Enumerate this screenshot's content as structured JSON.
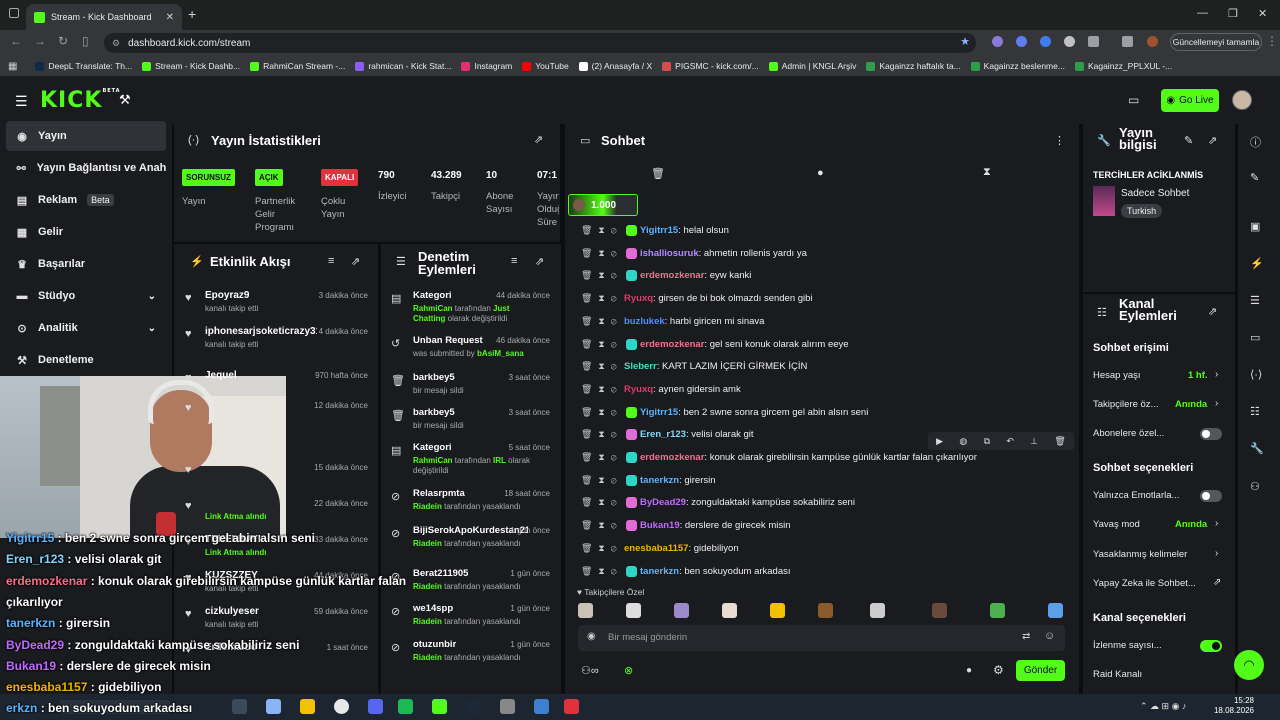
{
  "browser": {
    "tab_title": "Stream - Kick Dashboard",
    "url": "dashboard.kick.com/stream",
    "update_label": "Güncellemeyi tamamla",
    "bookmarks": [
      "DeepL Translate: Th...",
      "Stream - Kick Dashb...",
      "RahmiCan Stream -...",
      "rahmican - Kick Stat...",
      "Instagram",
      "YouTube",
      "(2) Anasayfa / X",
      "PIGSMC - kick.com/...",
      "Admin | KNGL Arşiv",
      "Kagainzz haftalık ta...",
      "Kagainzz beslenme...",
      "Kagainzz_PPLXUL -..."
    ],
    "bookmark_colors": [
      "#0f2b46",
      "#53fc18",
      "#53fc18",
      "#8b5cf6",
      "#e1306c",
      "#ff0000",
      "#ffffff",
      "#d94c4c",
      "#53fc18",
      "#2e9e4a",
      "#2e9e4a",
      "#2e9e4a"
    ]
  },
  "app": {
    "logo": "KICK",
    "logo_sup": "BETA",
    "go_live": "Go Live",
    "accent": "#53fc18"
  },
  "nav": [
    {
      "label": "Yayın",
      "icon": "broadcast-icon",
      "active": true
    },
    {
      "label": "Yayın Bağlantısı ve Anahtarı",
      "icon": "link-icon"
    },
    {
      "label": "Reklam",
      "icon": "ad-icon",
      "badge": "Beta"
    },
    {
      "label": "Gelir",
      "icon": "money-icon"
    },
    {
      "label": "Başarılar",
      "icon": "trophy-icon"
    },
    {
      "label": "Stüdyo",
      "icon": "studio-icon",
      "chevron": true
    },
    {
      "label": "Analitik",
      "icon": "chart-icon",
      "chevron": true
    },
    {
      "label": "Denetleme",
      "icon": "hammer-icon"
    }
  ],
  "stats": {
    "title": "Yayın İstatistikleri",
    "items": [
      {
        "badge": "SORUNSUZ",
        "label": "Yayın"
      },
      {
        "badge": "AÇIK",
        "label": "Partnerlik Gelir Programı"
      },
      {
        "badge": "KAPALI",
        "label": "Çoklu Yayın"
      },
      {
        "value": "790",
        "label": "İzleyici"
      },
      {
        "value": "43.289",
        "label": "Takipçi"
      },
      {
        "value": "10",
        "label": "Abone Sayısı"
      },
      {
        "value": "07:1",
        "label": "Yayın Olduğu Süre"
      }
    ]
  },
  "activity": {
    "title": "Etkinlik Akışı",
    "items": [
      {
        "name": "Epoyraz9",
        "sub": "kanalı takip etti",
        "time": "3 dakika önce"
      },
      {
        "name": "iphonesarjsoketicrazy31",
        "sub": "kanalı takip etti",
        "time": "4 dakika önce"
      },
      {
        "name": "Jequel",
        "sub": "",
        "time": "970 hafta önce"
      },
      {
        "name": "",
        "sub": "",
        "time": "12 dakika önce"
      },
      {
        "name": "",
        "sub": "",
        "time": "15 dakika önce"
      },
      {
        "name": "",
        "sub": "Link Atma alındı",
        "time": "22 dakika önce"
      },
      {
        "name": "TEKELBAYI",
        "sub": "Link Atma alındı",
        "time": "33 dakika önce"
      },
      {
        "name": "KUZSZZEY",
        "sub": "kanalı takip etti",
        "time": "44 dakika önce"
      },
      {
        "name": "cizkulyeser",
        "sub": "kanalı takip etti",
        "time": "59 dakika önce"
      },
      {
        "name": "Erdemaldo",
        "sub": "",
        "time": "1 saat önce"
      }
    ]
  },
  "moderation": {
    "title": "Denetim Eylemleri",
    "items": [
      {
        "name": "Kategori",
        "time": "44 dakika önce",
        "actor": "RahmiCan",
        "mid": " tarafından ",
        "target": "Just Chatting",
        "rest": " olarak değiştirildi",
        "icon": "category-icon"
      },
      {
        "name": "Unban Request",
        "time": "46 dakika önce",
        "actor": "",
        "mid": "was submitted by ",
        "target": "bAsiM_sana",
        "rest": "",
        "icon": "unban-icon"
      },
      {
        "name": "barkbey5",
        "time": "3 saat önce",
        "actor": "",
        "mid": "bir mesajı sildi",
        "target": "",
        "rest": "",
        "icon": "delete-icon"
      },
      {
        "name": "barkbey5",
        "time": "3 saat önce",
        "actor": "",
        "mid": "bir mesajı sildi",
        "target": "",
        "rest": "",
        "icon": "delete-icon"
      },
      {
        "name": "Kategori",
        "time": "5 saat önce",
        "actor": "RahmiCan",
        "mid": " tarafından ",
        "target": "IRL",
        "rest": " olarak değiştirildi",
        "icon": "category-icon"
      },
      {
        "name": "Relasrpmta",
        "time": "18 saat önce",
        "actor": "Riadein",
        "mid": " tarafından yasaklandı",
        "target": "",
        "rest": "",
        "icon": "ban-icon"
      },
      {
        "name": "BijiSerokApoKurdestan21",
        "time": "1 gün önce",
        "actor": "Riadein",
        "mid": " tarafından yasaklandı",
        "target": "",
        "rest": "",
        "icon": "ban-icon"
      },
      {
        "name": "Berat211905",
        "time": "1 gün önce",
        "actor": "Riadein",
        "mid": " tarafından yasaklandı",
        "target": "",
        "rest": "",
        "icon": "ban-icon"
      },
      {
        "name": "we14spp",
        "time": "1 gün önce",
        "actor": "Riadein",
        "mid": " tarafından yasaklandı",
        "target": "",
        "rest": "",
        "icon": "ban-icon"
      },
      {
        "name": "otuzunbir",
        "time": "1 gün önce",
        "actor": "Riadein",
        "mid": " tarafından yasaklandı",
        "target": "",
        "rest": "",
        "icon": "ban-icon"
      }
    ]
  },
  "chat": {
    "title": "Sohbet",
    "pinned_amount": "1.000",
    "messages": [
      {
        "user": "Yigitrr15",
        "color": "#5ab4ff",
        "text": ": helal olsun",
        "badge": "#53fc18"
      },
      {
        "user": "ishalliosuruk",
        "color": "#b08cff",
        "text": ": ahmetin rollenis yardı ya",
        "badge": "#e26bd8"
      },
      {
        "user": "erdemozkenar",
        "color": "#ff6b8a",
        "text": ": eyw kanki",
        "badge": "#2fd6c8"
      },
      {
        "user": "Ryuxq",
        "color": "#e0396b",
        "text": ": girsen de bi bok olmazdı senden gibi",
        "badge": ""
      },
      {
        "user": "buzlukek",
        "color": "#4f8cff",
        "text": ": harbi giricen mi sinava",
        "badge": ""
      },
      {
        "user": "erdemozkenar",
        "color": "#ff6b8a",
        "text": ": gel seni konuk olarak alırım eeye",
        "badge": "#2fd6c8"
      },
      {
        "user": "Sleberr",
        "color": "#3fe0c0",
        "text": ": KART LAZIM İÇERİ GİRMEK İÇİN",
        "badge": ""
      },
      {
        "user": "Ryuxq",
        "color": "#e0396b",
        "text": ": aynen gidersin amk",
        "badge": ""
      },
      {
        "user": "Yigitrr15",
        "color": "#5ab4ff",
        "text": ": ben 2 swne sonra gircem gel abin alsın seni",
        "badge": "#53fc18"
      },
      {
        "user": "Eren_r123",
        "color": "#7fd6ff",
        "text": ": velisi olarak git",
        "badge": "#e26bd8"
      },
      {
        "user": "erdemozkenar",
        "color": "#ff6b8a",
        "text": ": konuk olarak girebilirsin kampüse günlük kartlar falan çıkarılıyor",
        "badge": "#2fd6c8"
      },
      {
        "user": "tanerkzn",
        "color": "#5ab4ff",
        "text": ": girersin",
        "badge": "#2fd6c8"
      },
      {
        "user": "ByDead29",
        "color": "#c06bff",
        "text": ": zonguldaktaki kampüse sokabiliriz seni",
        "badge": "#e26bd8"
      },
      {
        "user": "Bukan19",
        "color": "#c06bff",
        "text": ": derslere de girecek misin",
        "badge": "#e26bd8"
      },
      {
        "user": "enesbaba1157",
        "color": "#f2b400",
        "text": ": gidebiliyon",
        "badge": ""
      },
      {
        "user": "tanerkzn",
        "color": "#5ab4ff",
        "text": ": ben sokuyodum arkadası",
        "badge": "#2fd6c8"
      }
    ],
    "emote_section": "Takipçilere Özel",
    "input_placeholder": "Bir mesaj gönderin",
    "send_label": "Gönder"
  },
  "stream_info": {
    "title": "Yayın bilgisi",
    "heading": "TERCİHLER ACİKLANMİS",
    "category": "Sadece Sohbet",
    "language": "Turkish"
  },
  "channel_actions": {
    "title": "Kanal Eylemleri",
    "chat_access": "Sohbet erişimi",
    "account_age": "Hesap yaşı",
    "account_age_val": "1 hf.",
    "followers_only": "Takipçilere öz...",
    "followers_only_val": "Anında",
    "subs_only": "Abonelere özel...",
    "chat_options": "Sohbet seçenekleri",
    "emotes_only": "Yalnızca Emotlarla...",
    "slow_mode": "Yavaş mod",
    "slow_mode_val": "Anında",
    "banned_words": "Yasaklanmış kelimeler",
    "ai_chat": "Yapay Zeka ile Sohbet...",
    "channel_options": "Kanal seçenekleri",
    "viewer_count": "İzlenme sayısı...",
    "raid": "Raid Kanalı"
  },
  "overlay_chat": [
    {
      "user": "Yigitrr15",
      "color": "#5ab4ff",
      "text": " : ben 2 swne sonra gircem gel abin alsın seni"
    },
    {
      "user": "Eren_r123",
      "color": "#7fd6ff",
      "text": " : velisi olarak git"
    },
    {
      "user": "erdemozkenar",
      "color": "#ff6b8a",
      "text": " : konuk olarak girebilirsin kampüse günlük kartlar falan"
    },
    {
      "user": "",
      "color": "#ffffff",
      "text": "çıkarılıyor"
    },
    {
      "user": "tanerkzn",
      "color": "#5ab4ff",
      "text": " : girersin"
    },
    {
      "user": "ByDead29",
      "color": "#c06bff",
      "text": " : zonguldaktaki kampüse sokabiliriz seni"
    },
    {
      "user": "Bukan19",
      "color": "#c06bff",
      "text": " : derslere de girecek misin"
    },
    {
      "user": "enesbaba1157",
      "color": "#f2b400",
      "text": " : gidebiliyon"
    },
    {
      "user": "erkzn",
      "color": "#5ab4ff",
      "text": " : ben sokuyodum arkadası"
    }
  ],
  "taskbar": {
    "time": "15:28",
    "date": "18.08.2026"
  }
}
